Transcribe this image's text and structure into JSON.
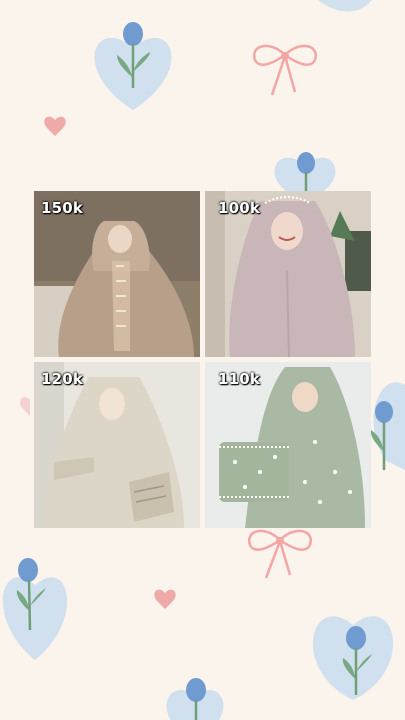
{
  "products": [
    {
      "price": "150k",
      "outfit_color": "#b89f8a",
      "bg_color": "#8c7e68"
    },
    {
      "price": "100k",
      "outfit_color": "#c8b6b8",
      "bg_color": "#d9d0c6"
    },
    {
      "price": "120k",
      "outfit_color": "#dcd6c8",
      "bg_color": "#e9e6df"
    },
    {
      "price": "110k",
      "outfit_color": "#a9b9a3",
      "bg_color": "#eaeceb"
    }
  ],
  "decorations": {
    "flower_color": "#8fb3da",
    "heart_color": "#f0a9a9",
    "bow_color": "#f2a6a6"
  }
}
